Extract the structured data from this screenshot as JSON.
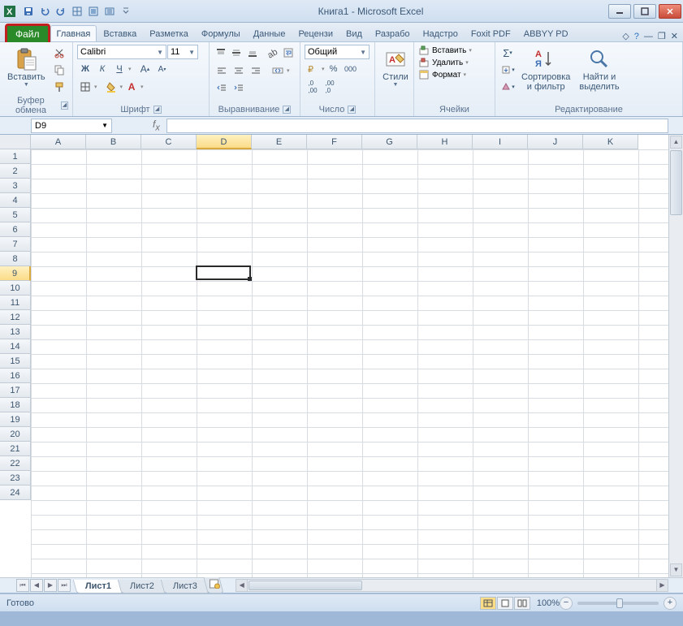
{
  "title": "Книга1  -  Microsoft Excel",
  "tabs": {
    "file": "Файл",
    "items": [
      "Главная",
      "Вставка",
      "Разметка",
      "Формулы",
      "Данные",
      "Рецензи",
      "Вид",
      "Разрабо",
      "Надстро",
      "Foxit PDF",
      "ABBYY PD"
    ],
    "active": 0
  },
  "ribbon": {
    "clipboard": {
      "paste": "Вставить",
      "label": "Буфер обмена"
    },
    "font": {
      "name": "Calibri",
      "size": "11",
      "label": "Шрифт",
      "bold": "Ж",
      "italic": "К",
      "underline": "Ч"
    },
    "alignment": {
      "label": "Выравнивание"
    },
    "number": {
      "format": "Общий",
      "label": "Число"
    },
    "styles": {
      "btn": "Стили"
    },
    "cells": {
      "insert": "Вставить",
      "delete": "Удалить",
      "format": "Формат",
      "label": "Ячейки"
    },
    "editing": {
      "sort": "Сортировка\nи фильтр",
      "find": "Найти и\nвыделить",
      "label": "Редактирование"
    }
  },
  "namebox": "D9",
  "columns": [
    "A",
    "B",
    "C",
    "D",
    "E",
    "F",
    "G",
    "H",
    "I",
    "J",
    "K"
  ],
  "rows_count": 24,
  "selected": {
    "col_index": 3,
    "row_index": 8
  },
  "sheets": {
    "items": [
      "Лист1",
      "Лист2",
      "Лист3"
    ],
    "active": 0
  },
  "status": {
    "ready": "Готово",
    "zoom": "100%"
  }
}
